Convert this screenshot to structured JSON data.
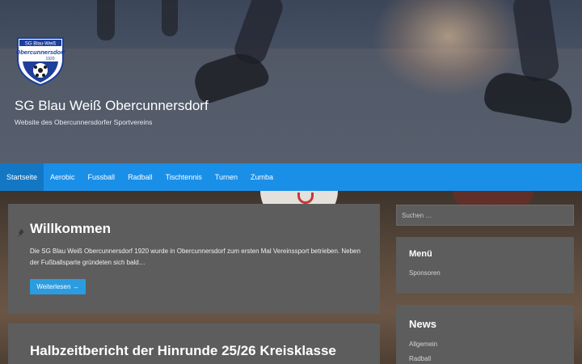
{
  "header": {
    "site_title": "SG Blau Weiß Obercunnersdorf",
    "site_description": "Website des Obercunnersdorfer Sportvereins",
    "logo": {
      "icon": "club-crest-icon",
      "text_top": "SG Blau-Weiß",
      "text_main": "Obercunnersdorf",
      "year": "1920"
    }
  },
  "nav": {
    "items": [
      {
        "label": "Startseite",
        "active": true
      },
      {
        "label": "Aerobic"
      },
      {
        "label": "Fussball"
      },
      {
        "label": "Radball"
      },
      {
        "label": "Tischtennis"
      },
      {
        "label": "Turnen"
      },
      {
        "label": "Zumba"
      }
    ]
  },
  "posts": [
    {
      "title": "Willkommen",
      "sticky_icon": "pin-icon",
      "excerpt": "Die SG Blau Weiß Obercunnersdorf 1920 wurde in Obercunnersdorf zum ersten Mal Vereinssport betrieben. Neben der Fußballsparte gründeten sich bald…",
      "read_more": "Weiterlesen →"
    },
    {
      "title": "Halbzeitbericht der Hinrunde 25/26 Kreisklasse"
    }
  ],
  "sidebar": {
    "search": {
      "placeholder": "Suchen …"
    },
    "widgets": [
      {
        "title": "Menü",
        "links": [
          "Sponsoren"
        ]
      },
      {
        "title": "News",
        "links": [
          "Allgemein",
          "Radball"
        ]
      }
    ]
  },
  "colors": {
    "nav_bg": "#1a8fe8",
    "button_bg": "#2b9ce0",
    "panel_bg": "#5d5d5d"
  }
}
